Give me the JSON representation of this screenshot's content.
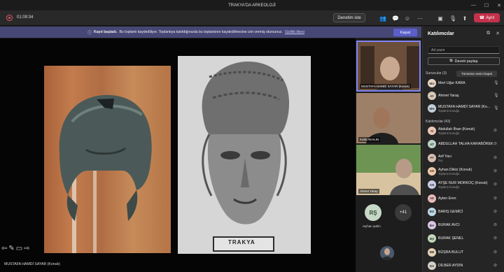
{
  "window": {
    "title": "TRAKYA'DA ARKEOLOJİ"
  },
  "toolbar": {
    "timer": "01:09:34",
    "monitor_label": "Denetim iste",
    "leave_label": "Ayrıl"
  },
  "banner": {
    "bold": "Kayıt başladı.",
    "text": "Bu toplantı kaydediliyor. Toplantıya katıldığınızda bu toplantının kaydedilmesine izin vermiş olursunuz.",
    "link": "Gizlilik ilkesi",
    "close_label": "Kapat"
  },
  "stage": {
    "presenter_name": "MUSTAFA HAMDİ SAYAR (Konuk)",
    "plaque_text": "TRAKYA"
  },
  "tiles": [
    {
      "name": "MUSTAFA HAMDİ SAYAR (Konuk)"
    },
    {
      "name": "Kutlu AKALIN"
    },
    {
      "name": "Ahmet Yaraş"
    }
  ],
  "tiles_extra": {
    "initials": "RŞ",
    "name": "reyhan şahin",
    "overflow": "+41"
  },
  "panel": {
    "title": "Katılımcılar",
    "search_placeholder": "Ad yazın",
    "share_label": "Daveti paylaş",
    "presenters_header": "Sunucular (3)",
    "mute_all_label": "Tümünün sesini kapat",
    "attendees_header": "Katılımcılar (43)",
    "presenters": [
      {
        "name": "Mert Uğur KARA",
        "role": "",
        "color": "#e8d5c4"
      },
      {
        "name": "Ahmet Yaraş",
        "role": "",
        "color": "#d8c8b8"
      },
      {
        "name": "MUSTAFA HAMDİ SAYAR (Ko...",
        "role": "Toplantı konuğu",
        "color": "#c5cfd7"
      }
    ],
    "attendees": [
      {
        "name": "Abdullah İlhan (Konuk)",
        "role": "Toplantı konuğu",
        "color": "#ebc7b5"
      },
      {
        "name": "ABDULLAH TALHA KARABÖREK",
        "role": "",
        "color": "#b9d2c3"
      },
      {
        "name": "Arif Yacı",
        "role": "Dış",
        "color": "#d7bfb0"
      },
      {
        "name": "Ayhan Dikici (Konuk)",
        "role": "Toplantı konuğu",
        "color": "#f0c9a8"
      },
      {
        "name": "AYŞE NUR MORKOÇ (Konuk)",
        "role": "Toplantı konuğu",
        "color": "#c9cde6"
      },
      {
        "name": "Ayten Eren",
        "role": "",
        "color": "#e9b9b9"
      },
      {
        "name": "BARIŞ GEMİCİ",
        "role": "",
        "color": "#bcd8e5"
      },
      {
        "name": "BURAK AVCI",
        "role": "",
        "color": "#dac6e2"
      },
      {
        "name": "BURAK ŞENEL",
        "role": "",
        "color": "#c3d9b9"
      },
      {
        "name": "BÜŞRA BULUT",
        "role": "",
        "color": "#e6d3b8"
      },
      {
        "name": "DİLBER AYDIN",
        "role": "",
        "color": "#d5d0c8"
      }
    ]
  }
}
